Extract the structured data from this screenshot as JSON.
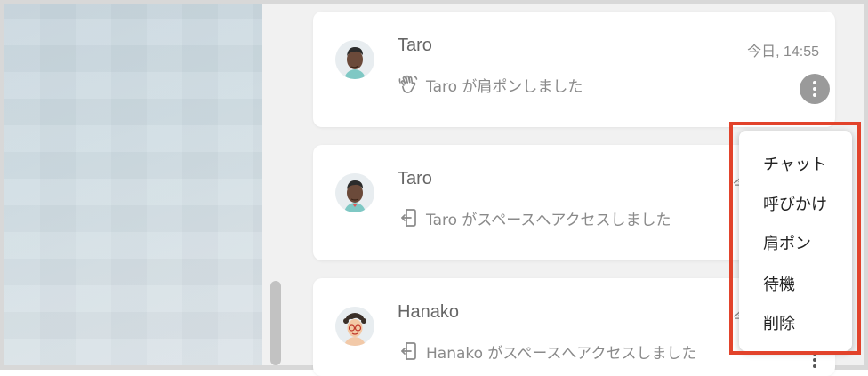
{
  "notifications": [
    {
      "name": "Taro",
      "time": "今日, 14:55",
      "message": "Taro が肩ポンしました",
      "icon": "wave-hand-icon"
    },
    {
      "name": "Taro",
      "time_partial": "今",
      "message": "Taro がスペースへアクセスしました",
      "icon": "enter-icon"
    },
    {
      "name": "Hanako",
      "time_partial": "今",
      "message": "Hanako がスペースへアクセスしました",
      "icon": "enter-icon"
    }
  ],
  "context_menu": {
    "items": [
      "チャット",
      "呼びかけ",
      "肩ポン",
      "待機",
      "削除"
    ]
  },
  "colors": {
    "highlight": "#e2432b",
    "panel_bg": "#f1f1f1",
    "card_bg": "#ffffff"
  }
}
